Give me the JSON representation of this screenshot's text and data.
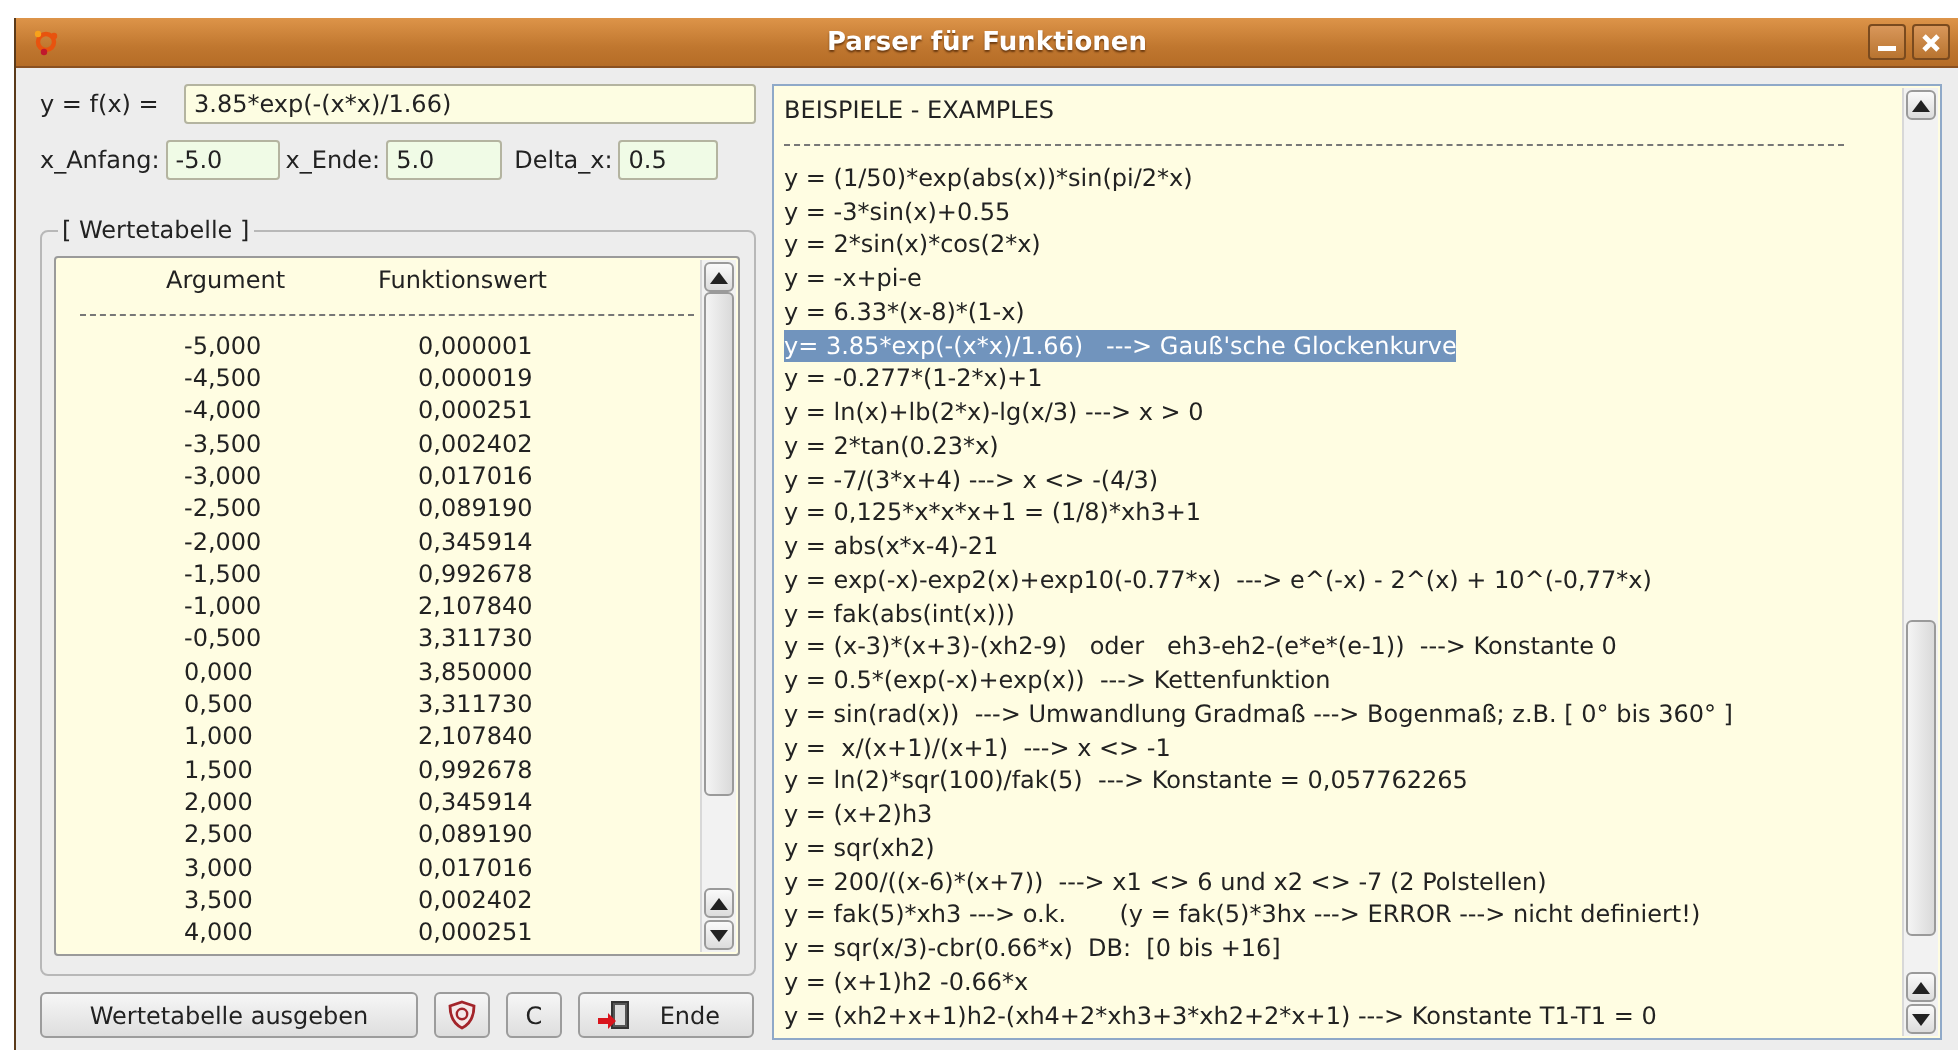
{
  "window": {
    "title": "Parser für Funktionen"
  },
  "function_field": {
    "label": "y = f(x) =",
    "value": "3.85*exp(-(x*x)/1.66)"
  },
  "range_fields": [
    {
      "label": "x_Anfang:",
      "value": "-5.0"
    },
    {
      "label": "x_Ende:",
      "value": "5.0"
    },
    {
      "label": "Delta_x:",
      "value": "0.5"
    }
  ],
  "value_table": {
    "title": "[ Wertetabelle ]",
    "columns": [
      "Argument",
      "Funktionswert"
    ],
    "rows": [
      [
        "-5,000",
        "0,000001"
      ],
      [
        "-4,500",
        "0,000019"
      ],
      [
        "-4,000",
        "0,000251"
      ],
      [
        "-3,500",
        "0,002402"
      ],
      [
        "-3,000",
        "0,017016"
      ],
      [
        "-2,500",
        "0,089190"
      ],
      [
        "-2,000",
        "0,345914"
      ],
      [
        "-1,500",
        "0,992678"
      ],
      [
        "-1,000",
        "2,107840"
      ],
      [
        "-0,500",
        "3,311730"
      ],
      [
        "0,000",
        "3,850000"
      ],
      [
        "0,500",
        "3,311730"
      ],
      [
        "1,000",
        "2,107840"
      ],
      [
        "1,500",
        "0,992678"
      ],
      [
        "2,000",
        "0,345914"
      ],
      [
        "2,500",
        "0,089190"
      ],
      [
        "3,000",
        "0,017016"
      ],
      [
        "3,500",
        "0,002402"
      ],
      [
        "4,000",
        "0,000251"
      ]
    ]
  },
  "buttons": [
    {
      "kind": "text",
      "label": "Wertetabelle ausgeben"
    },
    {
      "kind": "help"
    },
    {
      "kind": "text",
      "label": "C"
    },
    {
      "kind": "exit",
      "label": "Ende"
    }
  ],
  "examples": {
    "title": "BEISPIELE - EXAMPLES",
    "lines": [
      {
        "text": "y = (1/50)*exp(abs(x))*sin(pi/2*x)",
        "selected": false
      },
      {
        "text": "y = -3*sin(x)+0.55",
        "selected": false
      },
      {
        "text": "y = 2*sin(x)*cos(2*x)",
        "selected": false
      },
      {
        "text": "y = -x+pi-e",
        "selected": false
      },
      {
        "text": "y = 6.33*(x-8)*(1-x)",
        "selected": false
      },
      {
        "text": "y= 3.85*exp(-(x*x)/1.66)   ---> Gauß'sche Glockenkurve",
        "selected": true
      },
      {
        "text": "y = -0.277*(1-2*x)+1",
        "selected": false
      },
      {
        "text": "y = ln(x)+lb(2*x)-lg(x/3) ---> x > 0",
        "selected": false
      },
      {
        "text": "y = 2*tan(0.23*x)",
        "selected": false
      },
      {
        "text": "y = -7/(3*x+4) ---> x <> -(4/3)",
        "selected": false
      },
      {
        "text": "y = 0,125*x*x*x+1 = (1/8)*xh3+1",
        "selected": false
      },
      {
        "text": "y = abs(x*x-4)-21",
        "selected": false
      },
      {
        "text": "y = exp(-x)-exp2(x)+exp10(-0.77*x)  ---> e^(-x) - 2^(x) + 10^(-0,77*x)",
        "selected": false
      },
      {
        "text": "y = fak(abs(int(x)))",
        "selected": false
      },
      {
        "text": "y = (x-3)*(x+3)-(xh2-9)   oder   eh3-eh2-(e*e*(e-1))  ---> Konstante 0",
        "selected": false
      },
      {
        "text": "y = 0.5*(exp(-x)+exp(x))  ---> Kettenfunktion",
        "selected": false
      },
      {
        "text": "y = sin(rad(x))  ---> Umwandlung Gradmaß ---> Bogenmaß; z.B. [ 0° bis 360° ]",
        "selected": false
      },
      {
        "text": "y =  x/(x+1)/(x+1)  ---> x <> -1",
        "selected": false
      },
      {
        "text": "y = ln(2)*sqr(100)/fak(5)  ---> Konstante = 0,057762265",
        "selected": false
      },
      {
        "text": "y = (x+2)h3",
        "selected": false
      },
      {
        "text": "y = sqr(xh2)",
        "selected": false
      },
      {
        "text": "y = 200/((x-6)*(x+7))  ---> x1 <> 6 und x2 <> -7 (2 Polstellen)",
        "selected": false
      },
      {
        "text": "y = fak(5)*xh3 ---> o.k.       (y = fak(5)*3hx ---> ERROR ---> nicht definiert!)",
        "selected": false
      },
      {
        "text": "y = sqr(x/3)-cbr(0.66*x)  DB:  [0 bis +16]",
        "selected": false
      },
      {
        "text": "y = (x+1)h2 -0.66*x",
        "selected": false
      },
      {
        "text": "y = (xh2+x+1)h2-(xh4+2*xh3+3*xh2+2*x+1) ---> Konstante T1-T1 = 0",
        "selected": false
      }
    ]
  }
}
